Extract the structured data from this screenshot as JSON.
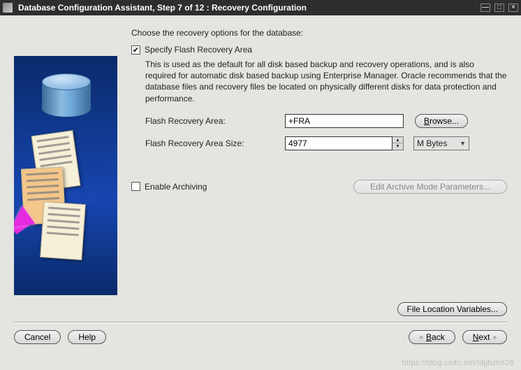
{
  "window": {
    "title": "Database Configuration Assistant, Step 7 of 12 : Recovery Configuration"
  },
  "instruction": "Choose the recovery options for the database:",
  "flash": {
    "checkbox_label": "Specify Flash Recovery Area",
    "checked": true,
    "description": "This is used as the default for all disk based backup and recovery operations, and is also required for automatic disk based backup using Enterprise Manager. Oracle recommends that the database files and recovery files be located on physically different disks for data protection and performance.",
    "area_label": "Flash Recovery Area:",
    "area_value": "+FRA",
    "browse_label": "Browse...",
    "size_label": "Flash Recovery Area Size:",
    "size_value": "4977",
    "unit_selected": "M Bytes"
  },
  "archive": {
    "checkbox_label": "Enable Archiving",
    "checked": false,
    "params_button": "Edit Archive Mode Parameters..."
  },
  "file_loc_button": "File Location Variables...",
  "footer": {
    "cancel": "Cancel",
    "help": "Help",
    "back": "Back",
    "next": "Next"
  },
  "watermark": "https://blog.csdn.net/ldjjbzh626"
}
